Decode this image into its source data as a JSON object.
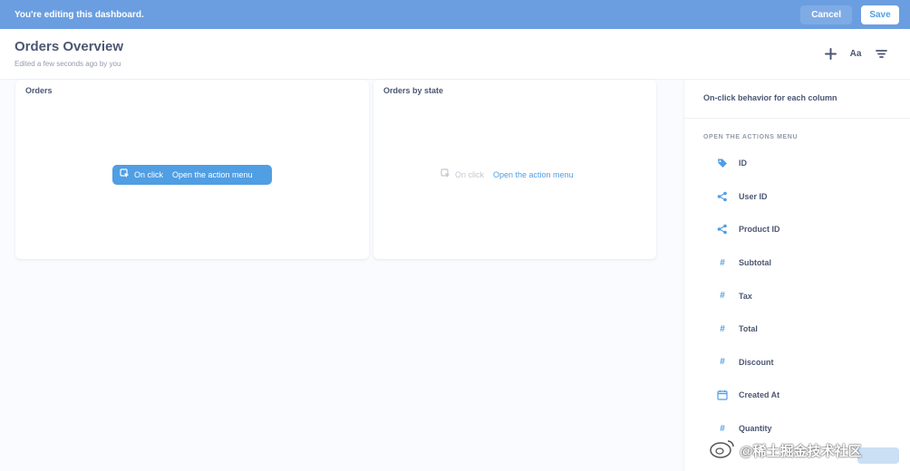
{
  "edit_bar": {
    "message": "You're editing this dashboard.",
    "cancel_label": "Cancel",
    "save_label": "Save"
  },
  "header": {
    "title": "Orders Overview",
    "subtitle": "Edited a few seconds ago by you",
    "icons": [
      "add-icon",
      "text-format-icon",
      "filter-icon"
    ],
    "text_icon_label": "Aa"
  },
  "cards": [
    {
      "title": "Orders",
      "onclick_label": "On click",
      "action_label": "Open the action menu",
      "state": "selected"
    },
    {
      "title": "Orders by state",
      "onclick_label": "On click",
      "action_label": "Open the action menu",
      "state": "default"
    }
  ],
  "sidebar": {
    "title": "On-click behavior for each column",
    "section": "OPEN THE ACTIONS MENU",
    "columns": [
      {
        "label": "ID",
        "icon": "tag-icon",
        "glyph": ""
      },
      {
        "label": "User ID",
        "icon": "connections-icon",
        "glyph": ""
      },
      {
        "label": "Product ID",
        "icon": "connections-icon",
        "glyph": ""
      },
      {
        "label": "Subtotal",
        "icon": "number-icon",
        "glyph": "#"
      },
      {
        "label": "Tax",
        "icon": "number-icon",
        "glyph": "#"
      },
      {
        "label": "Total",
        "icon": "number-icon",
        "glyph": "#"
      },
      {
        "label": "Discount",
        "icon": "number-icon",
        "glyph": "#"
      },
      {
        "label": "Created At",
        "icon": "calendar-icon",
        "glyph": ""
      },
      {
        "label": "Quantity",
        "icon": "number-icon",
        "glyph": "#"
      }
    ]
  },
  "watermark": {
    "text": "@稀土掘金技术社区"
  },
  "colors": {
    "banner": "#6a9ee0",
    "brand": "#509ee3",
    "text": "#4c5773",
    "muted": "#949aab"
  }
}
